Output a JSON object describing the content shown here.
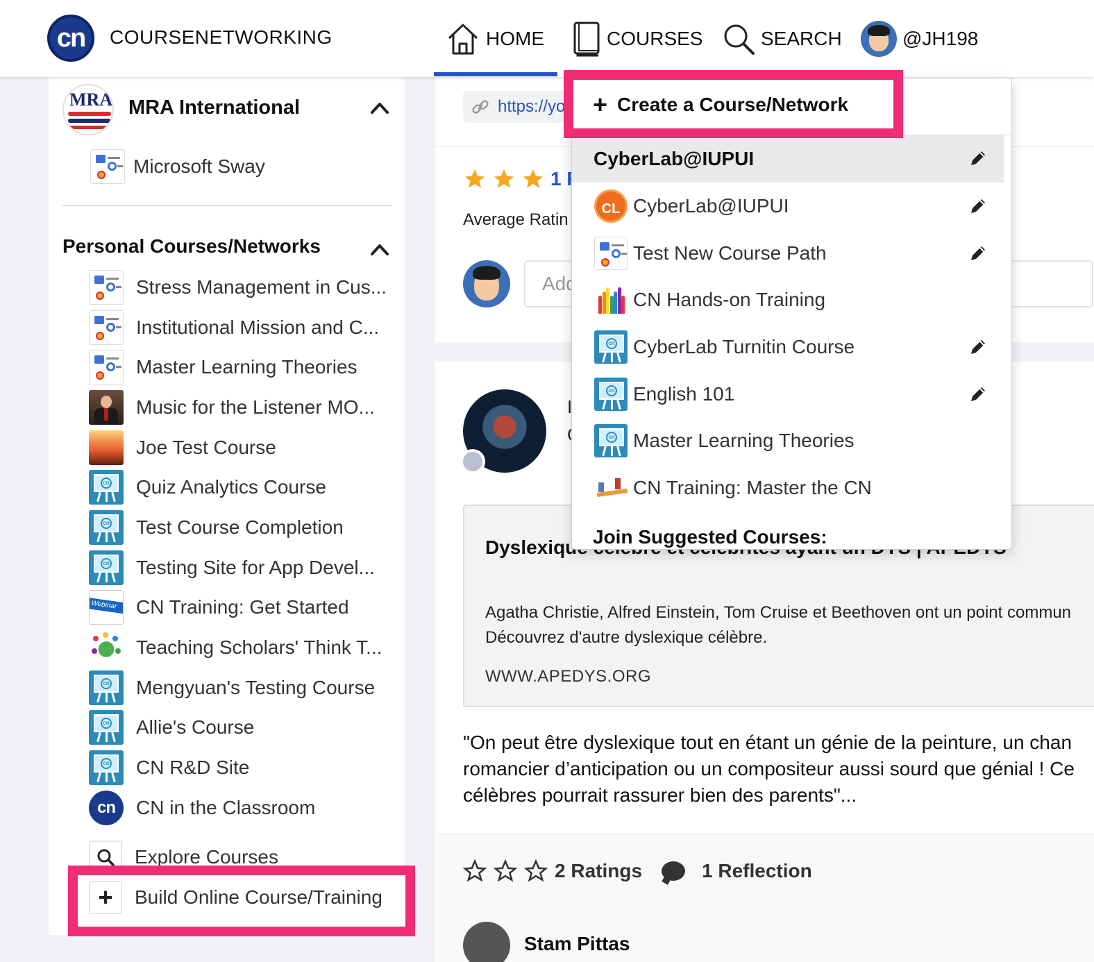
{
  "header": {
    "logo_text": "cn",
    "brand": "COURSENETWORKING",
    "nav": {
      "home": "HOME",
      "courses": "COURSES",
      "search": "SEARCH",
      "user": "@JH198"
    }
  },
  "sidebar": {
    "org": {
      "logo_text": "MRA",
      "name": "MRA International",
      "sub_item": "Microsoft Sway"
    },
    "section_title": "Personal Courses/Networks",
    "courses": [
      {
        "label": "Stress Management in Cus...",
        "icon": "checklist-icon"
      },
      {
        "label": "Institutional Mission and C...",
        "icon": "checklist-icon"
      },
      {
        "label": "Master Learning Theories",
        "icon": "checklist-icon"
      },
      {
        "label": "Music for the Listener MO...",
        "icon": "person-photo-icon"
      },
      {
        "label": "Joe Test Course",
        "icon": "fire-photo-icon"
      },
      {
        "label": "Quiz Analytics Course",
        "icon": "whiteboard-icon"
      },
      {
        "label": "Test Course Completion",
        "icon": "whiteboard-icon"
      },
      {
        "label": "Testing Site for App Devel...",
        "icon": "whiteboard-icon"
      },
      {
        "label": "CN Training: Get Started",
        "icon": "webinar-icon"
      },
      {
        "label": "Teaching Scholars' Think T...",
        "icon": "globe-people-icon"
      },
      {
        "label": "Mengyuan's Testing Course",
        "icon": "whiteboard-icon"
      },
      {
        "label": "Allie's Course",
        "icon": "whiteboard-icon"
      },
      {
        "label": "CN R&D Site",
        "icon": "whiteboard-icon"
      },
      {
        "label": "CN in the Classroom",
        "icon": "cn-logo-icon"
      }
    ],
    "explore": "Explore Courses",
    "build": "Build Online Course/Training",
    "colors": {
      "highlight": "#f02d74",
      "cn_blue": "#1a3a8c",
      "board_teal": "#2d8bb8"
    }
  },
  "feed": {
    "link_text": "https://yo",
    "rating_count": "1 R",
    "average_label": "Average Ratin",
    "comment_placeholder": "Add",
    "post": {
      "author_frag1": "I",
      "author_frag2": "C",
      "preview_title": "Dyslexique célèbre et célébrités ayant un DYS | APEDYS",
      "preview_desc_1": "Agatha Christie, Alfred Einstein, Tom Cruise et Beethoven ont un point commun",
      "preview_desc_2": "Découvrez d'autre dyslexique célèbre.",
      "preview_source": "WWW.APEDYS.ORG",
      "quote_1": "\"On peut être dyslexique tout en étant un génie de la peinture, un chan",
      "quote_2": "romancier d’anticipation ou un compositeur aussi sourd que génial ! Ce",
      "quote_3": "célèbres pourrait rassurer bien des parents\"...",
      "ratings": "2 Ratings",
      "reflections": "1 Reflection",
      "reply_author": "Stam Pittas"
    }
  },
  "dropdown": {
    "create": "Create a Course/Network",
    "current": "CyberLab@IUPUI",
    "items": [
      {
        "label": "CyberLab@IUPUI",
        "icon": "cl-logo-icon",
        "editable": true
      },
      {
        "label": "Test New Course Path",
        "icon": "checklist-icon",
        "editable": true
      },
      {
        "label": "CN Hands-on Training",
        "icon": "raised-hands-icon",
        "editable": false
      },
      {
        "label": "CyberLab Turnitin Course",
        "icon": "whiteboard-icon",
        "editable": true
      },
      {
        "label": "English 101",
        "icon": "whiteboard-icon",
        "editable": true
      },
      {
        "label": "Master Learning Theories",
        "icon": "whiteboard-icon",
        "editable": false
      },
      {
        "label": "CN Training: Master the CN",
        "icon": "learning-path-icon",
        "editable": false
      }
    ],
    "join": "Join Suggested Courses:"
  }
}
